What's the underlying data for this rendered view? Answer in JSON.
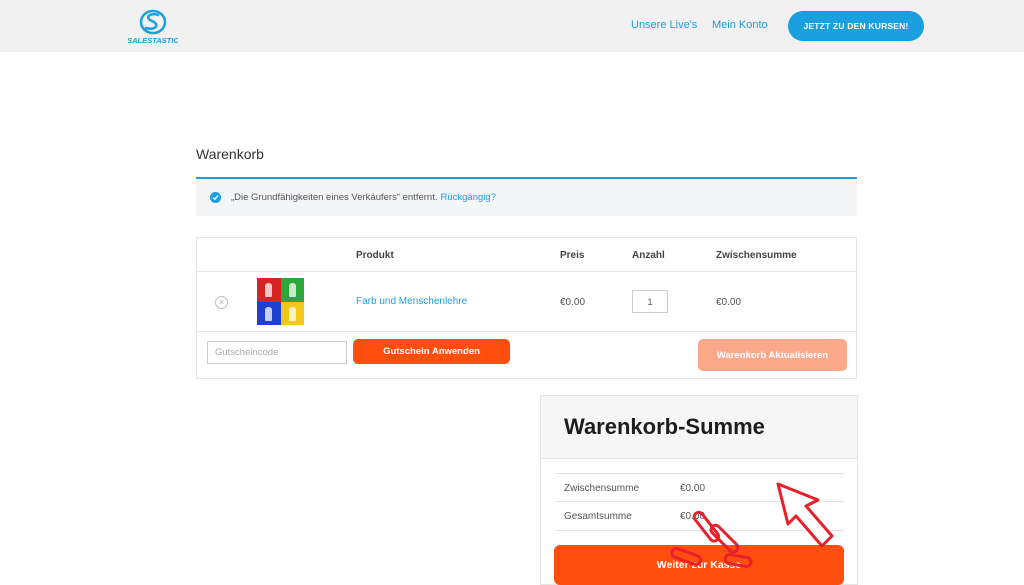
{
  "header": {
    "logo_text": "SALESTASTIC",
    "nav": [
      {
        "label": "Unsere Live's"
      },
      {
        "label": "Mein Konto"
      }
    ],
    "cta_label": "JETZT ZU DEN KURSEN!"
  },
  "page": {
    "title": "Warenkorb"
  },
  "notice": {
    "message": "„Die Grundfähigkeiten eines Verkäufers“ entfernt.",
    "undo_label": "Rückgängig?"
  },
  "cart": {
    "columns": {
      "product": "Produkt",
      "price": "Preis",
      "quantity": "Anzahl",
      "subtotal": "Zwischensumme"
    },
    "items": [
      {
        "name": "Farb und Menschenlehre",
        "price": "€0.00",
        "quantity": "1",
        "subtotal": "€0.00"
      }
    ],
    "coupon_placeholder": "Gutscheincode",
    "coupon_button": "Gutschein Anwenden",
    "update_button": "Warenkorb Aktualisieren"
  },
  "totals": {
    "title": "Warenkorb-Summe",
    "rows": [
      {
        "label": "Zwischensumme",
        "value": "€0.00"
      },
      {
        "label": "Gesamtsumme",
        "value": "€0.00"
      }
    ],
    "checkout_button": "Weiter zur Kasse"
  },
  "colors": {
    "accent_blue": "#1a9fdf",
    "accent_orange": "#ff4e0d",
    "disabled_orange": "#fca88a",
    "overlay_red": "#e8202a"
  }
}
